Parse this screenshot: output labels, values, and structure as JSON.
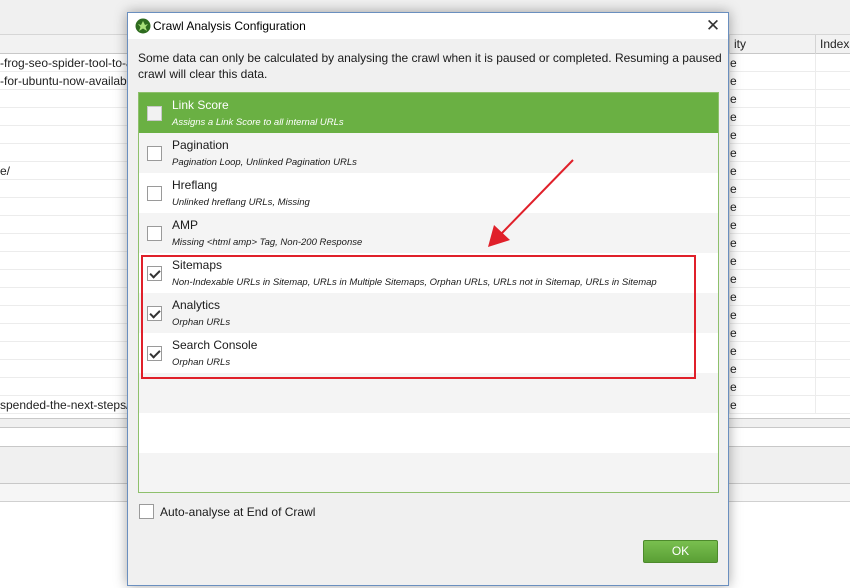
{
  "background": {
    "columns": [
      "ity",
      "Indexa"
    ],
    "rows": [
      {
        "url": "-frog-seo-spider-tool-to-a",
        "value": "e"
      },
      {
        "url": "-for-ubuntu-now-availab",
        "value": "e"
      },
      {
        "url": "",
        "value": "e"
      },
      {
        "url": "",
        "value": "e"
      },
      {
        "url": "",
        "value": "e"
      },
      {
        "url": "",
        "value": "e"
      },
      {
        "url": "e/",
        "value": "e"
      },
      {
        "url": "",
        "value": "e"
      },
      {
        "url": "",
        "value": "e"
      },
      {
        "url": "",
        "value": "e"
      },
      {
        "url": "",
        "value": "e"
      },
      {
        "url": "",
        "value": "e"
      },
      {
        "url": "",
        "value": "e"
      },
      {
        "url": "",
        "value": "e"
      },
      {
        "url": "",
        "value": "e"
      },
      {
        "url": "",
        "value": "e"
      },
      {
        "url": "",
        "value": "e"
      },
      {
        "url": "",
        "value": "e"
      },
      {
        "url": "",
        "value": "e"
      },
      {
        "url": "spended-the-next-steps/",
        "value": "e"
      }
    ]
  },
  "dialog": {
    "title": "Crawl Analysis Configuration",
    "close_glyph": "✕",
    "description": "Some data can only be calculated by analysing the crawl when it is paused or completed. Resuming a paused crawl will clear this data.",
    "options": [
      {
        "title": "Link Score",
        "subtitle": "Assigns a Link Score to all internal URLs",
        "checked": false,
        "selected": true
      },
      {
        "title": "Pagination",
        "subtitle": "Pagination Loop, Unlinked Pagination URLs",
        "checked": false,
        "selected": false
      },
      {
        "title": "Hreflang",
        "subtitle": "Unlinked hreflang URLs, Missing",
        "checked": false,
        "selected": false
      },
      {
        "title": "AMP",
        "subtitle": "Missing <html amp> Tag, Non-200 Response",
        "checked": false,
        "selected": false
      },
      {
        "title": "Sitemaps",
        "subtitle": "Non-Indexable URLs in Sitemap, URLs in Multiple Sitemaps, Orphan URLs, URLs not in Sitemap, URLs in Sitemap",
        "checked": true,
        "selected": false
      },
      {
        "title": "Analytics",
        "subtitle": "Orphan URLs",
        "checked": true,
        "selected": false
      },
      {
        "title": "Search Console",
        "subtitle": "Orphan URLs",
        "checked": true,
        "selected": false
      }
    ],
    "auto_analyse_label": "Auto-analyse at End of Crawl",
    "auto_analyse_checked": false,
    "ok_label": "OK"
  },
  "colors": {
    "selected_row": "#6ab043",
    "ok_button": "#6ab043",
    "annotation_red": "#e0202a"
  }
}
